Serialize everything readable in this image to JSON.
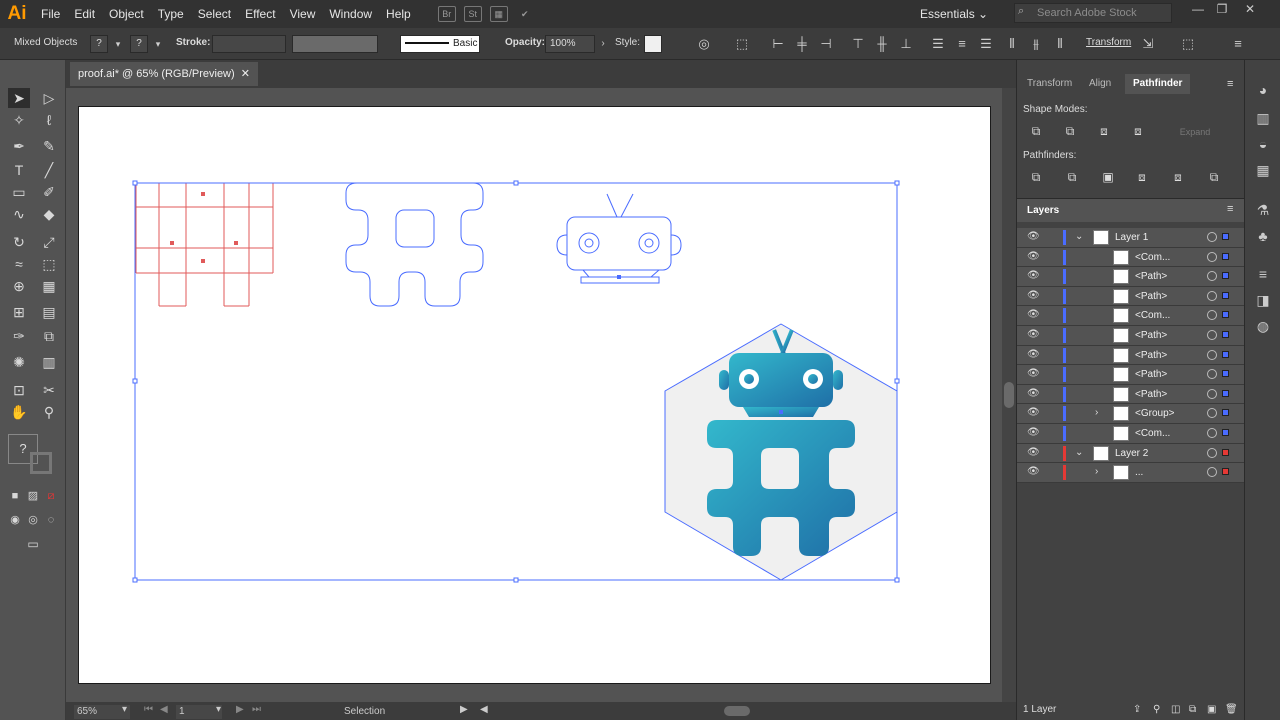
{
  "app": {
    "logo": "Ai",
    "menu": [
      "File",
      "Edit",
      "Object",
      "Type",
      "Select",
      "Effect",
      "View",
      "Window",
      "Help"
    ],
    "bridge_label": "Br",
    "stock_label": "St",
    "workspace": "Essentials",
    "stock_search_placeholder": "Search Adobe Stock"
  },
  "controlbar": {
    "selection_type": "Mixed Objects",
    "fill_label": "?",
    "stroke_label": "?",
    "stroke_text": "Stroke:",
    "brush_label": "Basic",
    "opacity_label": "Opacity:",
    "opacity_value": "100%",
    "style_label": "Style:",
    "transform_label": "Transform"
  },
  "document": {
    "tab_title": "proof.ai* @ 65% (RGB/Preview)",
    "zoom": "65%",
    "artboard_number": "1",
    "status_tool": "Selection"
  },
  "panels": {
    "tabs": [
      "Transform",
      "Align",
      "Pathfinder"
    ],
    "active_tab": "Pathfinder",
    "shape_modes_label": "Shape Modes:",
    "expand_label": "Expand",
    "pathfinders_label": "Pathfinders:",
    "layers_tab": "Layers",
    "layers_count": "1 Layer",
    "layers": [
      {
        "name": "Layer 1",
        "indent": 0,
        "arrow": "v",
        "color": "#4a6cff"
      },
      {
        "name": "<Com...",
        "indent": 1,
        "arrow": "",
        "color": "#4a6cff"
      },
      {
        "name": "<Path>",
        "indent": 1,
        "arrow": "",
        "color": "#4a6cff"
      },
      {
        "name": "<Path>",
        "indent": 1,
        "arrow": "",
        "color": "#4a6cff"
      },
      {
        "name": "<Com...",
        "indent": 1,
        "arrow": "",
        "color": "#4a6cff"
      },
      {
        "name": "<Path>",
        "indent": 1,
        "arrow": "",
        "color": "#4a6cff"
      },
      {
        "name": "<Path>",
        "indent": 1,
        "arrow": "",
        "color": "#4a6cff"
      },
      {
        "name": "<Path>",
        "indent": 1,
        "arrow": "",
        "color": "#4a6cff"
      },
      {
        "name": "<Path>",
        "indent": 1,
        "arrow": "",
        "color": "#4a6cff"
      },
      {
        "name": "<Group>",
        "indent": 1,
        "arrow": ">",
        "color": "#4a6cff"
      },
      {
        "name": "<Com...",
        "indent": 1,
        "arrow": "",
        "color": "#4a6cff"
      },
      {
        "name": "Layer 2",
        "indent": 0,
        "arrow": "v",
        "color": "#e53935"
      },
      {
        "name": "...",
        "indent": 1,
        "arrow": ">",
        "color": "#e53935"
      }
    ]
  },
  "colors": {
    "selection_blue": "#4a6cff",
    "grid_red": "#e05a5a",
    "teal_start": "#31b3c9",
    "teal_end": "#1f6fa7",
    "hexagon_fill": "#f0f0f0"
  }
}
